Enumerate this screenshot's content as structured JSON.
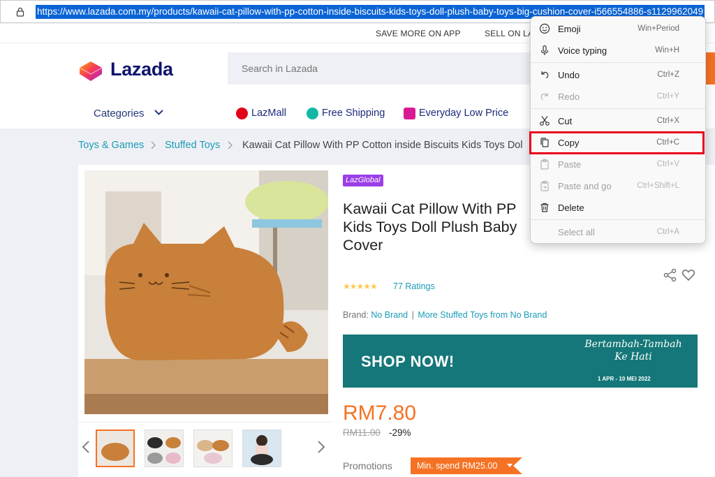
{
  "address_bar": {
    "url": "https://www.lazada.com.my/products/kawaii-cat-pillow-with-pp-cotton-inside-biscuits-kids-toys-doll-plush-baby-toys-big-cushion-cover-i566554886-s1129962049"
  },
  "top_strip": {
    "save_more": "SAVE MORE ON APP",
    "sell_on": "SELL ON LA"
  },
  "header": {
    "logo": "Lazada",
    "search_placeholder": "Search in Lazada",
    "categories": "Categories",
    "nav": [
      {
        "label": "LazMall",
        "icon": "lazmall-icon",
        "color": "#e2001a"
      },
      {
        "label": "Free Shipping",
        "icon": "free-shipping-icon",
        "color": "#12b8a5"
      },
      {
        "label": "Everyday Low Price",
        "icon": "low-price-icon",
        "color": "#d81b94"
      }
    ]
  },
  "breadcrumb": {
    "items": [
      "Toys & Games",
      "Stuffed Toys"
    ],
    "current": "Kawaii Cat Pillow With PP Cotton inside Biscuits Kids Toys Dol"
  },
  "product": {
    "badge": "LazGlobal",
    "title_lines": [
      "Kawaii Cat Pillow With PP",
      "Kids Toys Doll Plush Baby",
      "Cover"
    ],
    "stars": "★★★★★",
    "ratings": "77 Ratings",
    "brand_label": "Brand:",
    "brand_name": "No Brand",
    "brand_more": "More Stuffed Toys from No Brand",
    "banner": {
      "cta": "SHOP NOW!",
      "script_line1": "Bertambah-Tambah",
      "script_line2": "Ke Hati",
      "dates": "1 APR - 10 MEI 2022"
    },
    "price": "RM7.80",
    "old_price": "RM11.00",
    "discount": "-29%",
    "promotions_label": "Promotions",
    "promo_chip": "Min. spend RM25.00"
  },
  "context_menu": {
    "items": [
      {
        "label": "Emoji",
        "shortcut": "Win+Period",
        "icon": "emoji-icon",
        "enabled": true
      },
      {
        "label": "Voice typing",
        "shortcut": "Win+H",
        "icon": "microphone-icon",
        "enabled": true
      },
      {
        "label": "Undo",
        "shortcut": "Ctrl+Z",
        "icon": "undo-icon",
        "enabled": true
      },
      {
        "label": "Redo",
        "shortcut": "Ctrl+Y",
        "icon": "redo-icon",
        "enabled": false
      },
      {
        "label": "Cut",
        "shortcut": "Ctrl+X",
        "icon": "scissors-icon",
        "enabled": true
      },
      {
        "label": "Copy",
        "shortcut": "Ctrl+C",
        "icon": "copy-icon",
        "enabled": true,
        "highlighted": true
      },
      {
        "label": "Paste",
        "shortcut": "Ctrl+V",
        "icon": "paste-icon",
        "enabled": false
      },
      {
        "label": "Paste and go",
        "shortcut": "Ctrl+Shift+L",
        "icon": "paste-go-icon",
        "enabled": false
      },
      {
        "label": "Delete",
        "shortcut": "",
        "icon": "trash-icon",
        "enabled": true
      },
      {
        "label": "Select all",
        "shortcut": "Ctrl+A",
        "icon": "",
        "enabled": false
      }
    ]
  },
  "colors": {
    "accent": "#f57224",
    "link": "#1a9cb7",
    "highlight_box": "#e8001c",
    "url_selection": "#0a64d6"
  }
}
